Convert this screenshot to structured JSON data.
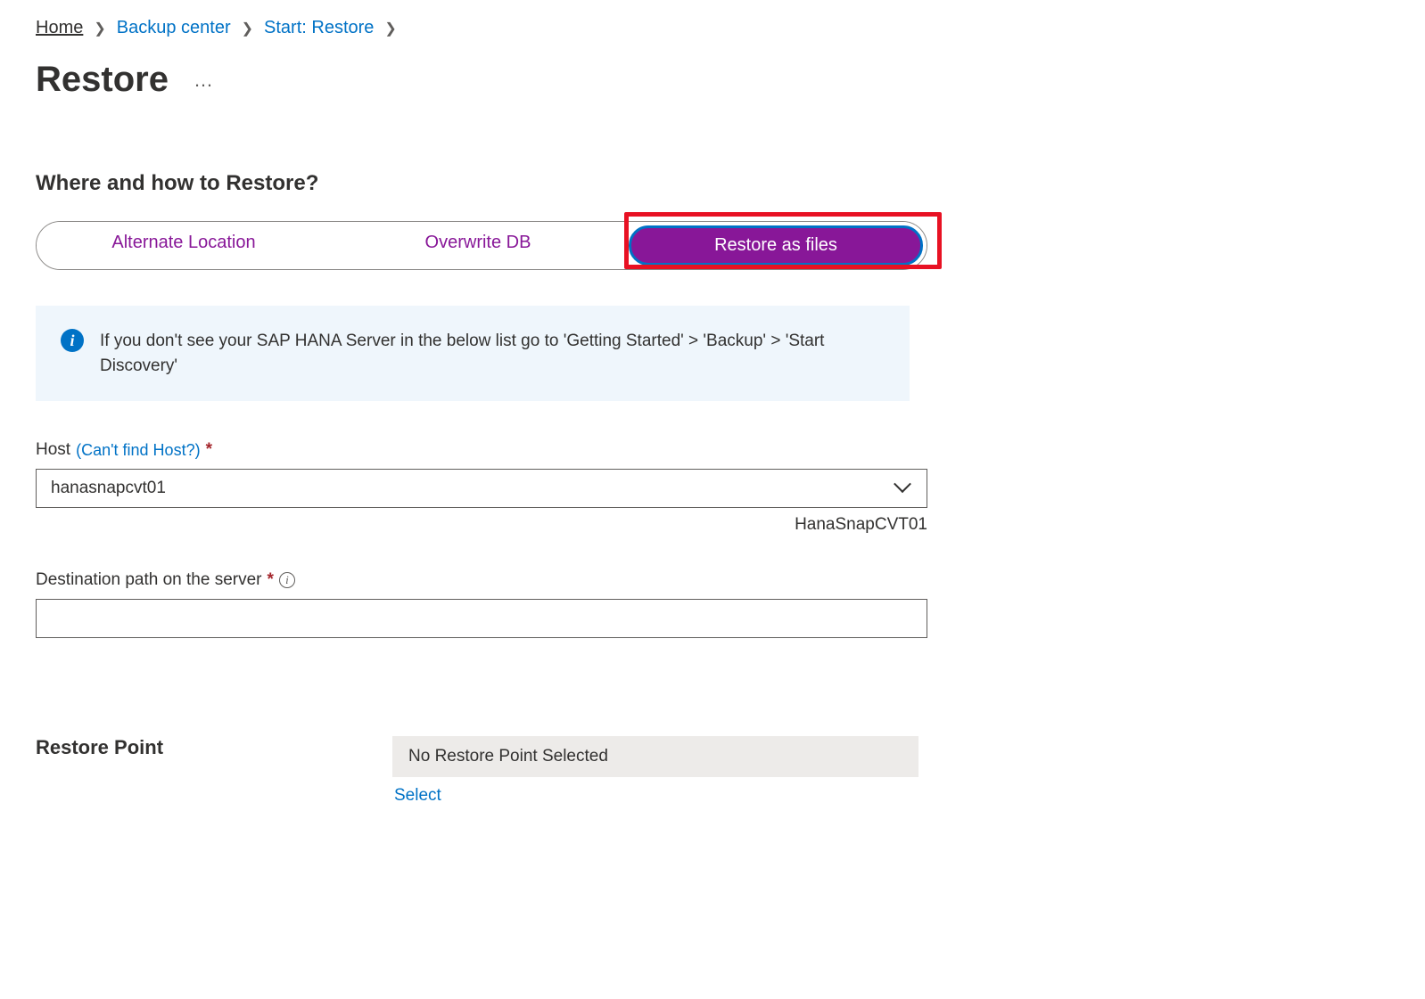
{
  "breadcrumb": {
    "items": [
      {
        "label": "Home"
      },
      {
        "label": "Backup center"
      },
      {
        "label": "Start: Restore"
      }
    ]
  },
  "page": {
    "title": "Restore"
  },
  "section": {
    "heading": "Where and how to Restore?"
  },
  "tabs": {
    "items": [
      {
        "label": "Alternate Location"
      },
      {
        "label": "Overwrite DB"
      },
      {
        "label": "Restore as files"
      }
    ]
  },
  "infobox": {
    "text": "If you don't see your SAP HANA Server in the below list go to 'Getting Started' > 'Backup' > 'Start Discovery'"
  },
  "host": {
    "label_prefix": "Host",
    "link_text": "(Can't find Host?)",
    "value": "hanasnapcvt01",
    "helper": "HanaSnapCVT01"
  },
  "destination": {
    "label": "Destination path on the server",
    "value": ""
  },
  "restore_point": {
    "label": "Restore Point",
    "value": "No Restore Point Selected",
    "select_label": "Select"
  }
}
